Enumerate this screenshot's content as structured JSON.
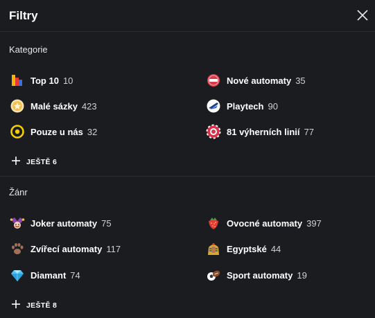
{
  "header": {
    "title": "Filtry",
    "close_icon": "close-icon"
  },
  "categories": {
    "title": "Kategorie",
    "items": [
      {
        "label": "Top 10",
        "count": "10",
        "icon": "top10-bar-icon"
      },
      {
        "label": "Nové automaty",
        "count": "35",
        "icon": "new-badge-icon"
      },
      {
        "label": "Malé sázky",
        "count": "423",
        "icon": "coin-star-icon"
      },
      {
        "label": "Playtech",
        "count": "90",
        "icon": "playtech-logo-icon"
      },
      {
        "label": "Pouze u nás",
        "count": "32",
        "icon": "exclusive-dot-icon"
      },
      {
        "label": "81 výherních linií",
        "count": "77",
        "icon": "paylines-chip-icon"
      }
    ],
    "more_label": "JEŠTĚ 6"
  },
  "genre": {
    "title": "Žánr",
    "items": [
      {
        "label": "Joker automaty",
        "count": "75",
        "icon": "joker-icon"
      },
      {
        "label": "Ovocné automaty",
        "count": "397",
        "icon": "strawberry-icon"
      },
      {
        "label": "Zvířecí automaty",
        "count": "117",
        "icon": "paw-icon"
      },
      {
        "label": "Egyptské",
        "count": "44",
        "icon": "pharaoh-icon"
      },
      {
        "label": "Diamant",
        "count": "74",
        "icon": "diamond-icon"
      },
      {
        "label": "Sport automaty",
        "count": "19",
        "icon": "sport-balls-icon"
      }
    ],
    "more_label": "JEŠTĚ 8"
  },
  "colors": {
    "background": "#1b1c1f",
    "divider": "#2d2f33",
    "text": "#ffffff",
    "count": "#d0d0d0"
  }
}
